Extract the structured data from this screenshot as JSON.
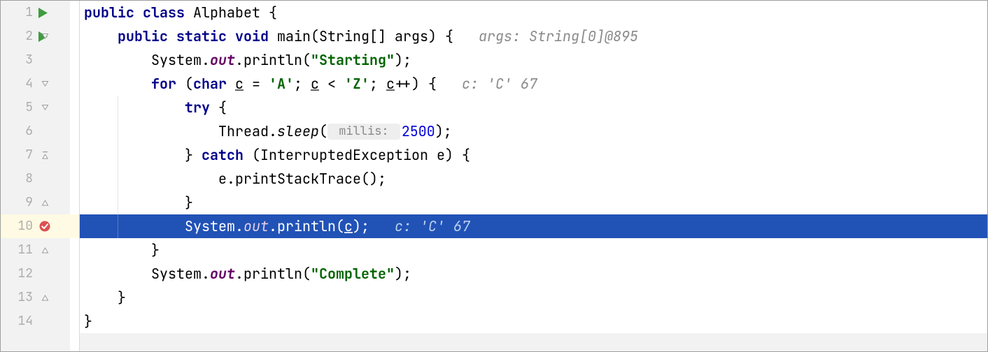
{
  "lines": {
    "1": "1",
    "2": "2",
    "3": "3",
    "4": "4",
    "5": "5",
    "6": "6",
    "7": "7",
    "8": "8",
    "9": "9",
    "10": "10",
    "11": "11",
    "12": "12",
    "13": "13",
    "14": "14"
  },
  "code": {
    "l1": {
      "kw1": "public class ",
      "cls": "Alphabet ",
      "brace": "{"
    },
    "l2": {
      "kw1": "public static void ",
      "mname": "main(String[] args) {   ",
      "hint": "args: String[0]@895"
    },
    "l3": {
      "pre": "System.",
      "out": "out",
      "mid": ".println(",
      "str": "\"Starting\"",
      "post": ");"
    },
    "l4": {
      "kw1": "for ",
      "p1": "(",
      "kw2": "char ",
      "v1": "c",
      "eq": " = ",
      "ch1": "'A'",
      "sep1": "; ",
      "v2": "c",
      "lt": " < ",
      "ch2": "'Z'",
      "sep2": "; ",
      "v3": "c",
      "inc": "++) {   ",
      "hint": "c: 'C' 67"
    },
    "l5": {
      "kw1": "try ",
      "brace": "{"
    },
    "l6": {
      "pre": "Thread.",
      "sleep": "sleep",
      "open": "(",
      "param": " millis: ",
      "num": "2500",
      "post": ");"
    },
    "l7": {
      "close": "} ",
      "kw1": "catch ",
      "rest": "(InterruptedException e) {"
    },
    "l8": {
      "txt": "e.printStackTrace();"
    },
    "l9": {
      "txt": "}"
    },
    "l10": {
      "pre": "System.",
      "out": "out",
      "mid": ".println(",
      "v": "c",
      "post": ");   ",
      "hint": "c: 'C' 67"
    },
    "l11": {
      "txt": "}"
    },
    "l12": {
      "pre": "System.",
      "out": "out",
      "mid": ".println(",
      "str": "\"Complete\"",
      "post": ");"
    },
    "l13": {
      "txt": "}"
    },
    "l14": {
      "txt": "}"
    }
  }
}
